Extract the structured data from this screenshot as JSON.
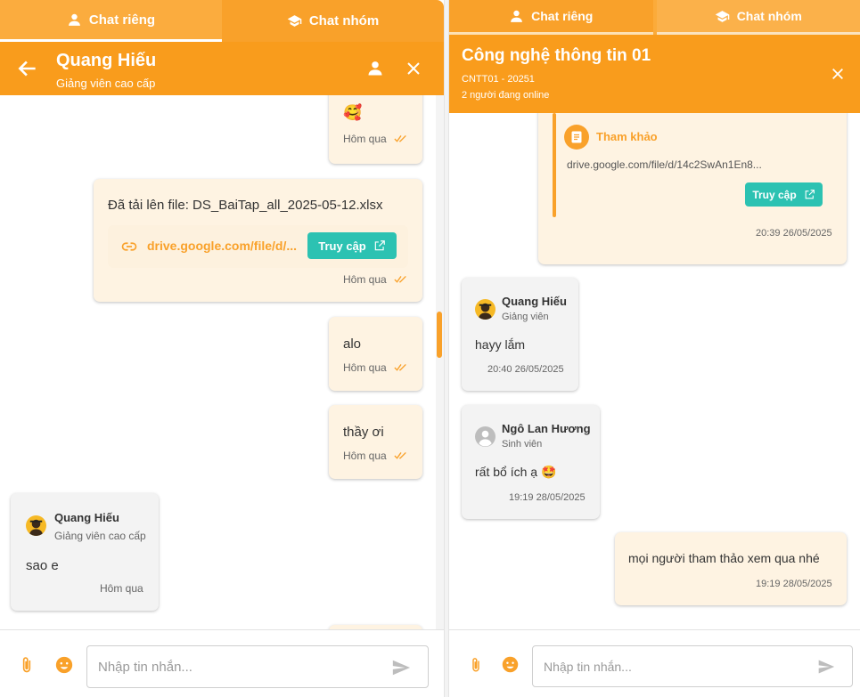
{
  "left": {
    "tabs": [
      {
        "label": "Chat riêng",
        "icon": "person-icon"
      },
      {
        "label": "Chat nhóm",
        "icon": "graduation-cap-icon"
      }
    ],
    "header": {
      "title": "Quang Hiếu",
      "subtitle": "Giảng viên cao cấp"
    },
    "messages": {
      "m1": {
        "emoji": "🥰",
        "time": "Hôm qua"
      },
      "m2": {
        "text": "Đã tải lên file: DS_BaiTap_all_2025-05-12.xlsx",
        "link": "drive.google.com/file/d/...",
        "button": "Truy cập",
        "time": "Hôm qua"
      },
      "m3": {
        "text": "alo",
        "time": "Hôm qua"
      },
      "m4": {
        "text": "thầy ơi",
        "time": "Hôm qua"
      },
      "m5": {
        "sender": "Quang Hiếu",
        "role": "Giảng viên cao cấp",
        "text": "sao e",
        "time": "Hôm qua"
      }
    },
    "input": {
      "placeholder": "Nhập tin nhắn..."
    }
  },
  "right": {
    "tabs": [
      {
        "label": "Chat riêng",
        "icon": "person-icon"
      },
      {
        "label": "Chat nhóm",
        "icon": "graduation-cap-icon"
      }
    ],
    "header": {
      "title": "Công nghệ thông tin 01",
      "class_code": "CNTT01 - 20251",
      "online": "2 người đang online"
    },
    "messages": {
      "ref": {
        "title": "Tham khảo",
        "link": "drive.google.com/file/d/14c2SwAn1En8...",
        "button": "Truy cập",
        "time": "20:39 26/05/2025"
      },
      "r1": {
        "sender": "Quang Hiếu",
        "role": "Giảng viên",
        "text": "hayy lắm",
        "time": "20:40 26/05/2025"
      },
      "r2": {
        "sender": "Ngô Lan Hương",
        "role": "Sinh viên",
        "text": "rất bổ ích ạ",
        "emoji": "🤩",
        "time": "19:19 28/05/2025"
      },
      "r3": {
        "text": "mọi người tham thảo xem qua nhé",
        "time": "19:19 28/05/2025"
      }
    },
    "input": {
      "placeholder": "Nhập tin nhắn..."
    }
  },
  "colors": {
    "primary": "#f99c1c",
    "accent": "#2cc2b2",
    "mine_bubble": "#fef3e2",
    "their_bubble": "#f3f3f3"
  }
}
